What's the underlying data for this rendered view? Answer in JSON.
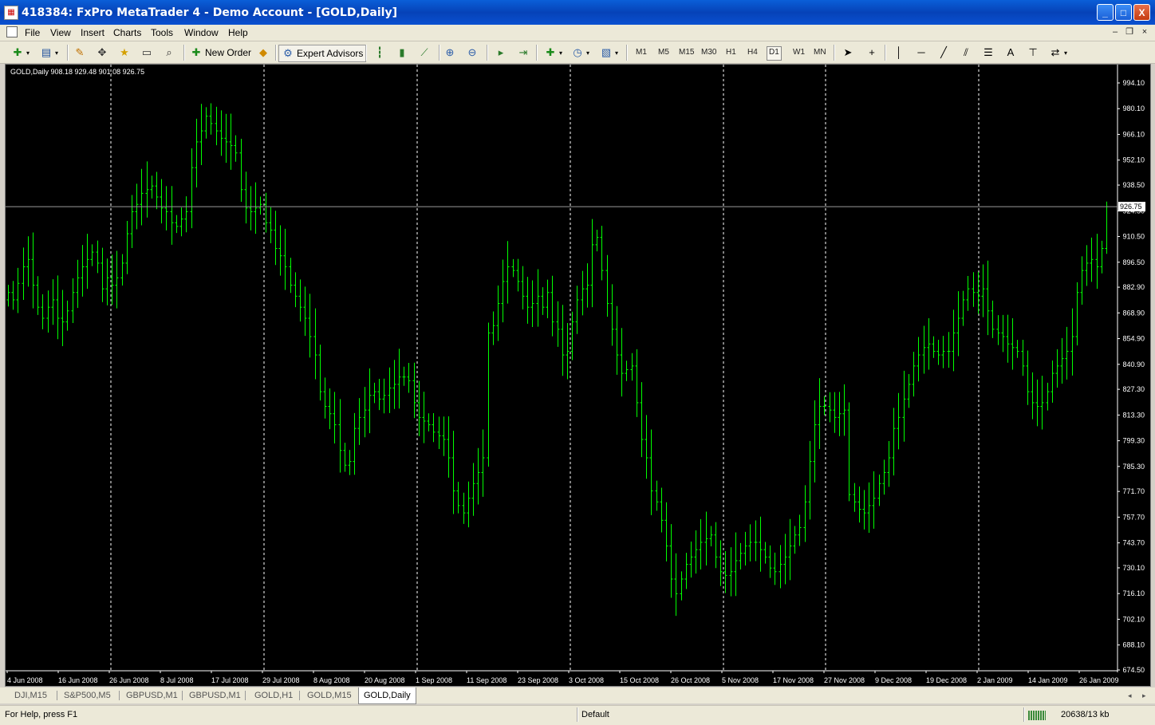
{
  "window": {
    "title": "418384: FxPro MetaTrader 4 - Demo Account - [GOLD,Daily]",
    "minimize": "_",
    "maximize": "□",
    "close": "X",
    "doc_minimize": "–",
    "doc_restore": "❐",
    "doc_close": "×"
  },
  "menu": [
    "File",
    "View",
    "Insert",
    "Charts",
    "Tools",
    "Window",
    "Help"
  ],
  "toolbar": {
    "new_order": "New Order",
    "expert_advisors": "Expert Advisors",
    "timeframes": [
      "M1",
      "M5",
      "M15",
      "M30",
      "H1",
      "H4",
      "D1",
      "W1",
      "MN"
    ],
    "active_timeframe": "D1",
    "text_tool": "A"
  },
  "chart": {
    "header": "GOLD,Daily  908.18 929.48 901.08 926.75",
    "bar_color": "#00ff00",
    "bg_color": "#000000",
    "current_price_label": "926.75",
    "current_price": 926.75
  },
  "chart_data": {
    "type": "ohlc-bar",
    "symbol": "GOLD",
    "timeframe": "Daily",
    "last_bar": {
      "open": 908.18,
      "high": 929.48,
      "low": 901.08,
      "close": 926.75
    },
    "ylim": [
      674.5,
      1001.0
    ],
    "y_ticks": [
      "994.10",
      "980.10",
      "966.10",
      "952.10",
      "938.50",
      "924.50",
      "910.50",
      "896.50",
      "882.90",
      "868.90",
      "854.90",
      "840.90",
      "827.30",
      "813.30",
      "799.30",
      "785.30",
      "771.70",
      "757.70",
      "743.70",
      "730.10",
      "716.10",
      "702.10",
      "688.10",
      "674.50"
    ],
    "x_ticks": [
      "4 Jun 2008",
      "16 Jun 2008",
      "26 Jun 2008",
      "8 Jul 2008",
      "17 Jul 2008",
      "29 Jul 2008",
      "8 Aug 2008",
      "20 Aug 2008",
      "1 Sep 2008",
      "11 Sep 2008",
      "23 Sep 2008",
      "3 Oct 2008",
      "15 Oct 2008",
      "26 Oct 2008",
      "5 Nov 2008",
      "17 Nov 2008",
      "27 Nov 2008",
      "9 Dec 2008",
      "19 Dec 2008",
      "2 Jan 2009",
      "14 Jan 2009",
      "26 Jan 2009"
    ],
    "separators": [
      "26 Jun 2008",
      "29 Jul 2008",
      "1 Sep 2008",
      "3 Oct 2008",
      "5 Nov 2008",
      "27 Nov 2008",
      "2 Jan 2009"
    ],
    "closes": [
      880,
      876,
      885,
      894,
      898,
      884,
      872,
      866,
      872,
      876,
      866,
      864,
      870,
      880,
      888,
      894,
      898,
      902,
      896,
      882,
      888,
      884,
      888,
      896,
      912,
      924,
      928,
      934,
      936,
      938,
      932,
      926,
      924,
      918,
      916,
      920,
      924,
      948,
      962,
      968,
      976,
      972,
      968,
      964,
      962,
      960,
      956,
      936,
      926,
      924,
      926,
      928,
      918,
      914,
      904,
      900,
      894,
      884,
      878,
      872,
      866,
      856,
      846,
      826,
      818,
      814,
      808,
      794,
      786,
      788,
      806,
      812,
      816,
      824,
      826,
      822,
      824,
      828,
      830,
      834,
      834,
      832,
      820,
      812,
      810,
      808,
      804,
      802,
      800,
      790,
      772,
      764,
      760,
      768,
      776,
      782,
      790,
      858,
      862,
      874,
      886,
      894,
      892,
      886,
      878,
      872,
      874,
      878,
      872,
      880,
      864,
      860,
      846,
      848,
      864,
      876,
      882,
      884,
      906,
      910,
      892,
      874,
      860,
      846,
      836,
      838,
      840,
      820,
      800,
      790,
      772,
      766,
      756,
      742,
      724,
      716,
      724,
      732,
      736,
      740,
      744,
      746,
      748,
      736,
      728,
      726,
      728,
      734,
      738,
      742,
      744,
      744,
      740,
      736,
      730,
      728,
      732,
      736,
      742,
      748,
      752,
      766,
      788,
      808,
      818,
      818,
      816,
      812,
      814,
      816,
      770,
      766,
      762,
      760,
      764,
      768,
      776,
      782,
      790,
      806,
      812,
      822,
      830,
      840,
      846,
      850,
      852,
      848,
      846,
      848,
      848,
      858,
      866,
      876,
      882,
      880,
      878,
      882,
      870,
      860,
      858,
      856,
      852,
      850,
      848,
      840,
      826,
      820,
      818,
      820,
      826,
      836,
      840,
      844,
      848,
      856,
      880,
      892,
      896,
      898,
      894,
      904,
      926.75
    ]
  },
  "tabs": [
    "DJI,M15",
    "S&P500,M5",
    "GBPUSD,M1",
    "GBPUSD,M1",
    "GOLD,H1",
    "GOLD,M15",
    "GOLD,Daily"
  ],
  "active_tab": "GOLD,Daily",
  "tab_nav": {
    "left": "◂",
    "right": "▸"
  },
  "status": {
    "help": "For Help, press F1",
    "profile": "Default",
    "traffic": "20638/13 kb"
  }
}
